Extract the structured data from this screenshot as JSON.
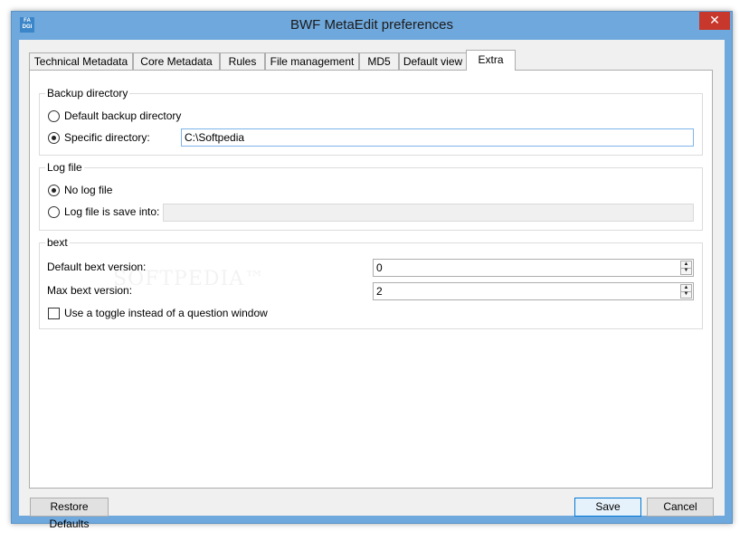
{
  "window": {
    "title": "BWF MetaEdit preferences",
    "app_icon_text": "FA DGI",
    "close_glyph": "✕"
  },
  "tabs": [
    {
      "label": "Technical Metadata",
      "active": false
    },
    {
      "label": "Core Metadata",
      "active": false
    },
    {
      "label": "Rules",
      "active": false
    },
    {
      "label": "File management",
      "active": false
    },
    {
      "label": "MD5",
      "active": false
    },
    {
      "label": "Default view",
      "active": false
    },
    {
      "label": "Extra",
      "active": true
    }
  ],
  "backup": {
    "title": "Backup directory",
    "default_label": "Default backup directory",
    "specific_label": "Specific directory:",
    "specific_value": "C:\\Softpedia",
    "selected": "specific"
  },
  "logfile": {
    "title": "Log file",
    "none_label": "No log file",
    "save_label": "Log file is save into:",
    "save_value": "",
    "selected": "none"
  },
  "bext": {
    "title": "bext",
    "default_version_label": "Default bext version:",
    "default_version_value": "0",
    "max_version_label": "Max bext version:",
    "max_version_value": "2",
    "toggle_label": "Use a toggle instead of a question window",
    "toggle_checked": false
  },
  "buttons": {
    "restore": "Restore Defaults",
    "save": "Save",
    "cancel": "Cancel"
  },
  "spin_up_glyph": "▲",
  "spin_down_glyph": "▼",
  "colors": {
    "titlebar": "#6fa8dc",
    "close": "#c7372b",
    "focus_border": "#0078d7"
  }
}
